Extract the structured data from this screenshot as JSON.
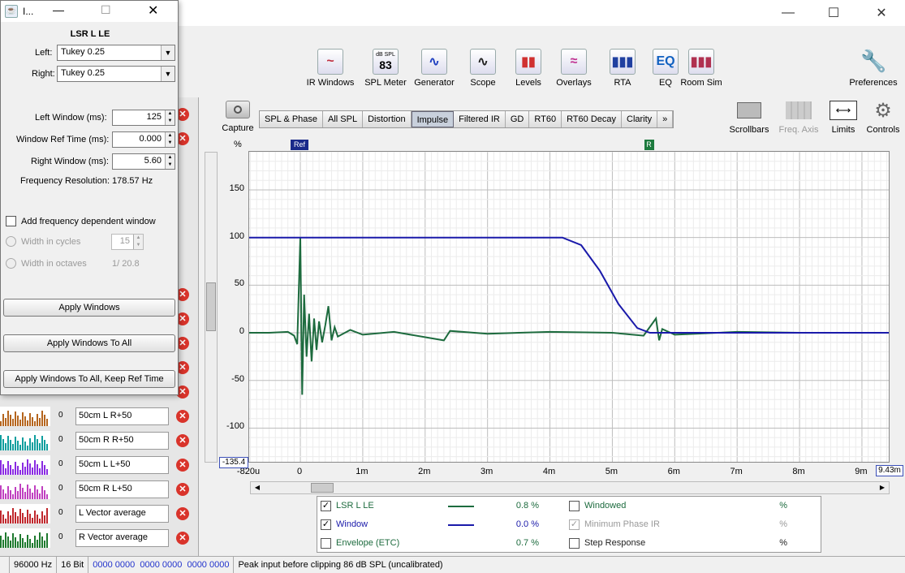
{
  "toolbar": {
    "tools": [
      {
        "label": "IR Windows",
        "icon": "ir-windows-icon"
      },
      {
        "label": "SPL Meter",
        "icon": "spl-meter-icon",
        "spl_top": "dB SPL",
        "spl_value": "83"
      },
      {
        "label": "Generator",
        "icon": "generator-icon"
      },
      {
        "label": "Scope",
        "icon": "scope-icon"
      },
      {
        "label": "Levels",
        "icon": "levels-icon"
      },
      {
        "label": "Overlays",
        "icon": "overlays-icon"
      },
      {
        "label": "RTA",
        "icon": "rta-icon"
      },
      {
        "label": "EQ",
        "icon": "eq-icon"
      },
      {
        "label": "Room Sim",
        "icon": "room-sim-icon"
      }
    ],
    "preferences": "Preferences",
    "capture": "Capture",
    "scrollbars": "Scrollbars",
    "freq_axis": "Freq. Axis",
    "limits": "Limits",
    "controls": "Controls"
  },
  "tabs": [
    "SPL & Phase",
    "All SPL",
    "Distortion",
    "Impulse",
    "Filtered IR",
    "GD",
    "RT60",
    "RT60 Decay",
    "Clarity",
    "»"
  ],
  "active_tab": "Impulse",
  "dialog": {
    "title": "I...",
    "name": "LSR L LE",
    "left_label": "Left:",
    "left_value": "Tukey 0.25",
    "right_label": "Right:",
    "right_value": "Tukey 0.25",
    "left_window_label": "Left Window (ms):",
    "left_window_value": "125",
    "ref_time_label": "Window Ref Time (ms):",
    "ref_time_value": "0.000",
    "right_window_label": "Right Window (ms):",
    "right_window_value": "5.60",
    "freq_res_label": "Frequency Resolution:",
    "freq_res_value": "178.57 Hz",
    "fdw_label": "Add frequency dependent window",
    "cycles_label": "Width in cycles",
    "cycles_value": "15",
    "octaves_label": "Width in octaves",
    "octaves_value": "1/ 20.8",
    "apply": "Apply Windows",
    "apply_all": "Apply Windows To All",
    "apply_all_keep": "Apply Windows To All, Keep Ref Time"
  },
  "measurements": [
    {
      "label": "50cm L R+50",
      "color": "#b5651d"
    },
    {
      "label": "50cm R R+50",
      "color": "#0e9e9e"
    },
    {
      "label": "50cm L L+50",
      "color": "#8a2be2"
    },
    {
      "label": "50cm R L+50",
      "color": "#c040c0"
    },
    {
      "label": "L Vector average",
      "color": "#c0282d"
    },
    {
      "label": "R Vector average",
      "color": "#1f7a2f"
    }
  ],
  "chart_data": {
    "type": "line",
    "ylabel": "%",
    "y_ticks": [
      "150",
      "100",
      "50",
      "0",
      "-50",
      "-100"
    ],
    "y_min_label": "-135.4",
    "x_ticks": [
      "-820u",
      "0",
      "1m",
      "2m",
      "3m",
      "4m",
      "5m",
      "6m",
      "7m",
      "8m",
      "9m"
    ],
    "x_max_label": "9.43m",
    "ylim": [
      -135.4,
      190
    ],
    "xlim_ms": [
      -0.82,
      9.43
    ],
    "markers": [
      {
        "label": "Ref",
        "x_ms": 0
      },
      {
        "label": "R",
        "x_ms": 5.6
      }
    ],
    "series": [
      {
        "name": "Window",
        "color": "#1a1aaa",
        "points": [
          [
            -0.82,
            100
          ],
          [
            4.2,
            100
          ],
          [
            4.5,
            92
          ],
          [
            4.8,
            65
          ],
          [
            5.1,
            30
          ],
          [
            5.4,
            5
          ],
          [
            5.6,
            0
          ],
          [
            9.43,
            0
          ]
        ]
      },
      {
        "name": "LSR L LE",
        "color": "#1d6b3e",
        "points": [
          [
            -0.82,
            0
          ],
          [
            -0.5,
            0
          ],
          [
            -0.2,
            1
          ],
          [
            -0.1,
            -3
          ],
          [
            -0.05,
            -12
          ],
          [
            0,
            100
          ],
          [
            0.03,
            -65
          ],
          [
            0.06,
            40
          ],
          [
            0.1,
            -25
          ],
          [
            0.14,
            20
          ],
          [
            0.18,
            -30
          ],
          [
            0.22,
            15
          ],
          [
            0.26,
            -18
          ],
          [
            0.3,
            12
          ],
          [
            0.35,
            -10
          ],
          [
            0.4,
            8
          ],
          [
            0.45,
            28
          ],
          [
            0.5,
            -8
          ],
          [
            0.55,
            6
          ],
          [
            0.6,
            -4
          ],
          [
            0.8,
            3
          ],
          [
            1.0,
            -2
          ],
          [
            1.5,
            1
          ],
          [
            2.3,
            -8
          ],
          [
            2.4,
            2
          ],
          [
            3.0,
            -1
          ],
          [
            4.0,
            1
          ],
          [
            5.0,
            0
          ],
          [
            5.5,
            -3
          ],
          [
            5.7,
            15
          ],
          [
            5.75,
            -8
          ],
          [
            5.8,
            4
          ],
          [
            6.0,
            -2
          ],
          [
            7.0,
            1
          ],
          [
            8.0,
            0
          ],
          [
            9.43,
            0
          ]
        ]
      }
    ]
  },
  "legend": {
    "rows": [
      {
        "left_label": "LSR L LE",
        "left_checked": true,
        "left_color": "#1d6b3e",
        "left_value": "0.8 %",
        "right_label": "Windowed",
        "right_checked": false,
        "right_value": "%",
        "right_color": "#1d6b3e"
      },
      {
        "left_label": "Window",
        "left_checked": true,
        "left_color": "#1a1aaa",
        "left_value": "0.0 %",
        "right_label": "Minimum Phase IR",
        "right_checked": true,
        "right_value": "%",
        "right_color": "#999999"
      },
      {
        "left_label": "Envelope (ETC)",
        "left_checked": false,
        "left_color": "#1d6b3e",
        "left_value": "0.7 %",
        "right_label": "Step Response",
        "right_checked": false,
        "right_value": "%",
        "right_color": "#222222"
      }
    ]
  },
  "status": {
    "rate": "96000 Hz",
    "bits": "16 Bit",
    "meters": "0000 0000  0000 0000  0000 0000",
    "message": "Peak input before clipping 86 dB SPL (uncalibrated)"
  }
}
